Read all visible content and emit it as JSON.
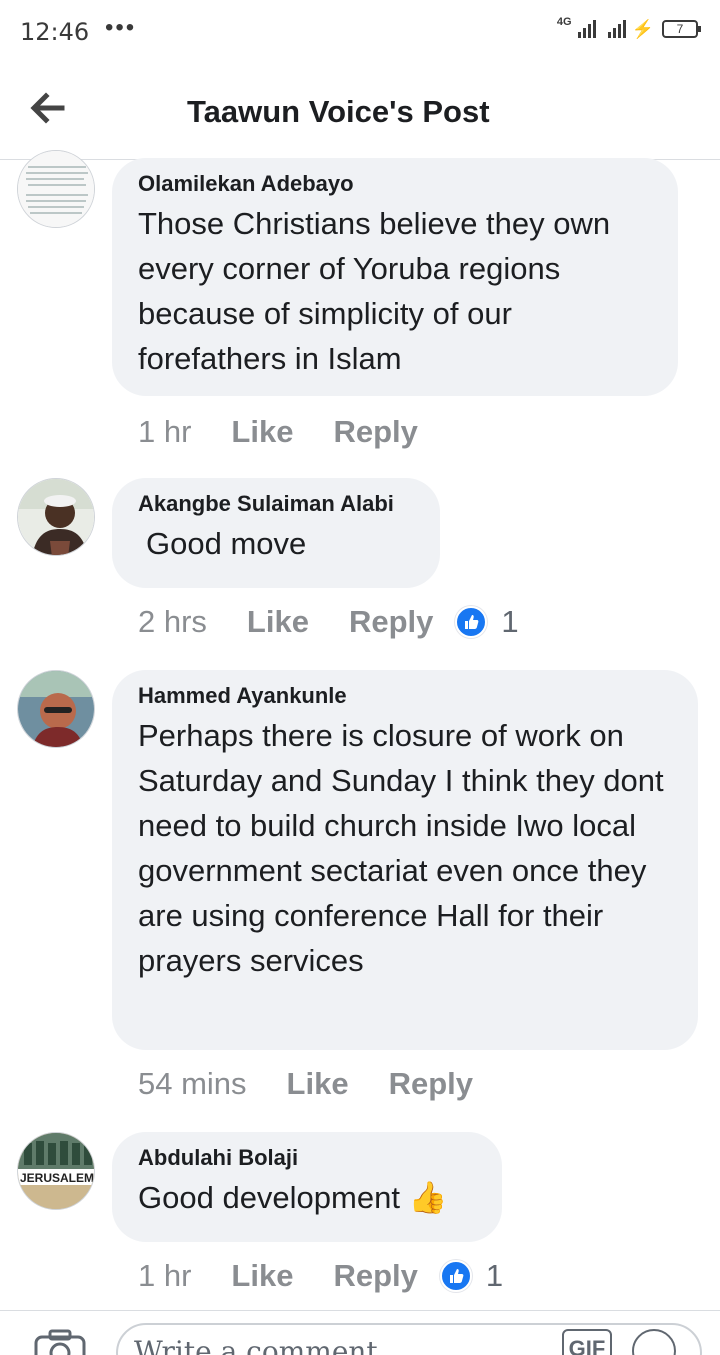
{
  "status_bar": {
    "time": "12:46",
    "dots": "•••",
    "network": "4G",
    "battery": "7"
  },
  "header": {
    "title": "Taawun Voice's Post"
  },
  "comments": [
    {
      "author": "Olamilekan Adebayo",
      "text": "Those Christians believe they own every corner of Yoruba regions because of simplicity of our forefathers in Islam",
      "time": "1 hr",
      "like_label": "Like",
      "reply_label": "Reply"
    },
    {
      "author": "Akangbe Sulaiman Alabi",
      "text": "Good move",
      "time": "2 hrs",
      "like_label": "Like",
      "reply_label": "Reply",
      "reactions": "1"
    },
    {
      "author": "Hammed Ayankunle",
      "text": "Perhaps there is closure of work on Saturday and Sunday  I think they dont need to build church inside Iwo local government sectariat even once they are using conference Hall for their prayers services",
      "time": "54 mins",
      "like_label": "Like",
      "reply_label": "Reply"
    },
    {
      "author": "Abdulahi Bolaji",
      "text": "Good development",
      "emoji": "👍",
      "time": "1 hr",
      "like_label": "Like",
      "reply_label": "Reply",
      "reactions": "1",
      "avatar_text": "JERUSALEM"
    }
  ],
  "composer": {
    "placeholder": "Write a comment...",
    "gif_label": "GIF"
  },
  "colors": {
    "bubble": "#f0f2f5",
    "accent": "#1877f2",
    "meta": "#8a8d91"
  }
}
